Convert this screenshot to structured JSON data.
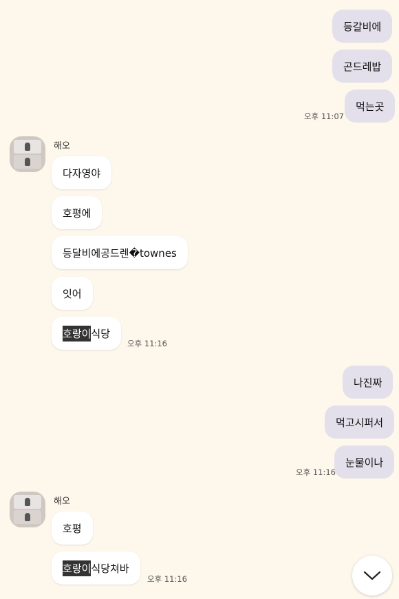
{
  "outgoing_group_1": {
    "messages": [
      "등갈비에",
      "곤드레밥",
      "먹는곳"
    ],
    "time": "오후 11:07"
  },
  "incoming_group_1": {
    "sender": "해오",
    "messages": [
      "다자영야",
      "호평에",
      "등달비에공드렌�townes",
      "잇어"
    ],
    "highlight_message": {
      "highlight": "호랑이",
      "rest": "식당"
    },
    "time": "오후 11:16"
  },
  "outgoing_group_2": {
    "messages": [
      "나진짜",
      "먹고시퍼서",
      "눈물이나"
    ],
    "time": "오후 11:16"
  },
  "incoming_group_2": {
    "sender": "해오",
    "messages": [
      "호평"
    ],
    "highlight_message": {
      "highlight": "호랑이",
      "rest": "식당쳐바"
    },
    "time": "오후 11:16"
  },
  "scroll_button": {
    "icon": "chevron-down-icon"
  }
}
